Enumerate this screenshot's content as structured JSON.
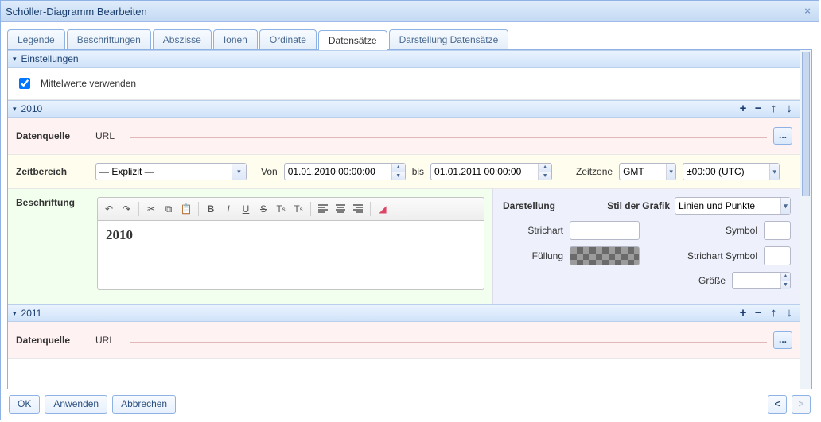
{
  "window": {
    "title": "Schöller-Diagramm Bearbeiten",
    "close_glyph": "×"
  },
  "tabs": [
    "Legende",
    "Beschriftungen",
    "Abszisse",
    "Ionen",
    "Ordinate",
    "Datensätze",
    "Darstellung Datensätze"
  ],
  "active_tab": "Datensätze",
  "settings": {
    "header": "Einstellungen",
    "mittelwerte_label": "Mittelwerte verwenden",
    "mittelwerte_checked": true
  },
  "datasets": [
    {
      "title": "2010",
      "datenquelle_label": "Datenquelle",
      "datenquelle_type": "URL",
      "zeitbereich_label": "Zeitbereich",
      "zeitbereich_value": "— Explizit —",
      "von_label": "Von",
      "von_value": "01.01.2010 00:00:00",
      "bis_label": "bis",
      "bis_value": "01.01.2011 00:00:00",
      "zeitzone_label": "Zeitzone",
      "zeitzone_value": "GMT",
      "zeitzone_offset": "±00:00 (UTC)",
      "beschriftung_label": "Beschriftung",
      "beschriftung_text": "2010",
      "darstellung": {
        "header": "Darstellung",
        "stil_label": "Stil der Grafik",
        "stil_value": "Linien und Punkte",
        "strichart_label": "Strichart",
        "symbol_label": "Symbol",
        "fuellung_label": "Füllung",
        "strichart_symbol_label": "Strichart Symbol",
        "groesse_label": "Größe",
        "groesse_value": ""
      }
    },
    {
      "title": "2011",
      "datenquelle_label": "Datenquelle",
      "datenquelle_type": "URL"
    }
  ],
  "footer": {
    "ok": "OK",
    "apply": "Anwenden",
    "cancel": "Abbrechen",
    "prev": "<",
    "next": ">"
  },
  "glyphs": {
    "browse": "...",
    "plus": "+",
    "minus": "−",
    "up": "↑",
    "down": "↓",
    "disclose": "▾",
    "combo": "▾",
    "spin_up": "▲",
    "spin_down": "▼"
  }
}
